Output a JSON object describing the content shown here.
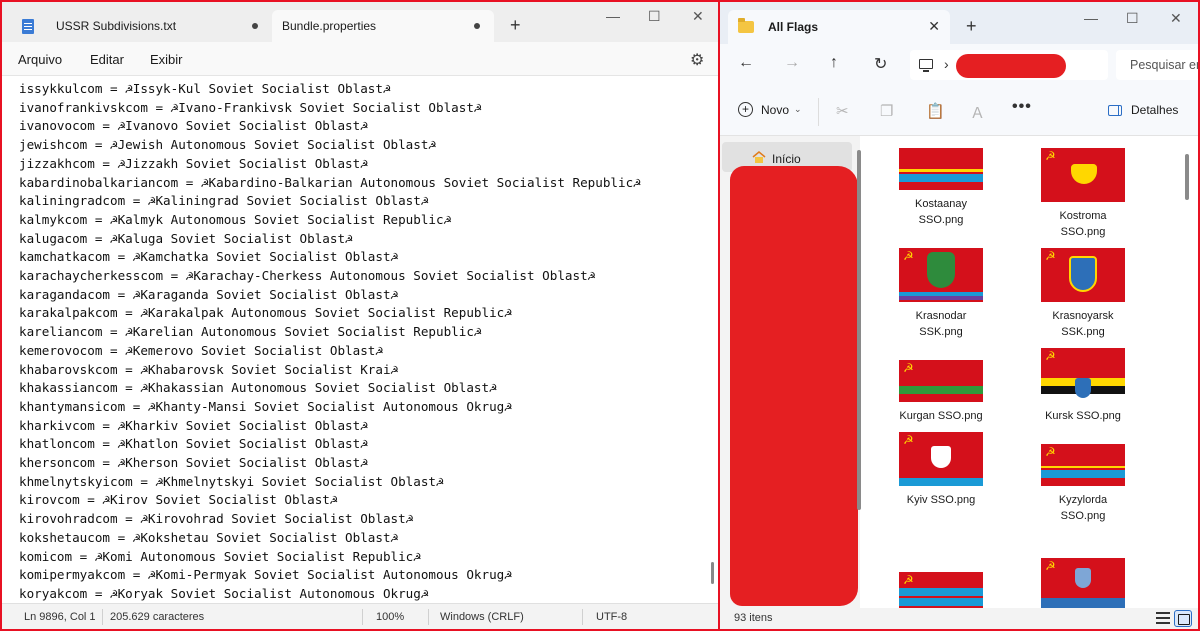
{
  "notepad": {
    "tabs": [
      {
        "label": "USSR Subdivisions.txt",
        "modified": true
      },
      {
        "label": "Bundle.properties",
        "modified": true,
        "active": true
      }
    ],
    "menu": [
      "Arquivo",
      "Editar",
      "Exibir"
    ],
    "lines": [
      "issykkulcom = ☭Issyk-Kul Soviet Socialist Oblast☭",
      "ivanofrankivskcom = ☭Ivano-Frankivsk Soviet Socialist Oblast☭",
      "ivanovocom = ☭Ivanovo Soviet Socialist Oblast☭",
      "jewishcom = ☭Jewish Autonomous Soviet Socialist Oblast☭",
      "jizzakhcom = ☭Jizzakh Soviet Socialist Oblast☭",
      "kabardinobalkariancom = ☭Kabardino-Balkarian Autonomous Soviet Socialist Republic☭",
      "kaliningradcom = ☭Kaliningrad Soviet Socialist Oblast☭",
      "kalmykcom = ☭Kalmyk Autonomous Soviet Socialist Republic☭",
      "kalugacom = ☭Kaluga Soviet Socialist Oblast☭",
      "kamchatkacom = ☭Kamchatka Soviet Socialist Oblast☭",
      "karachaycherkesscom = ☭Karachay-Cherkess Autonomous Soviet Socialist Oblast☭",
      "karagandacom = ☭Karaganda Soviet Socialist Oblast☭",
      "karakalpakcom = ☭Karakalpak Autonomous Soviet Socialist Republic☭",
      "kareliancom = ☭Karelian Autonomous Soviet Socialist Republic☭",
      "kemerovocom = ☭Kemerovo Soviet Socialist Oblast☭",
      "khabarovskcom = ☭Khabarovsk Soviet Socialist Krai☭",
      "khakassiancom = ☭Khakassian Autonomous Soviet Socialist Oblast☭",
      "khantymansicom = ☭Khanty-Mansi Soviet Socialist Autonomous Okrug☭",
      "kharkivcom = ☭Kharkiv Soviet Socialist Oblast☭",
      "khatloncom = ☭Khatlon Soviet Socialist Oblast☭",
      "khersoncom = ☭Kherson Soviet Socialist Oblast☭",
      "khmelnytskyicom = ☭Khmelnytskyi Soviet Socialist Oblast☭",
      "kirovcom = ☭Kirov Soviet Socialist Oblast☭",
      "kirovohradcom = ☭Kirovohrad Soviet Socialist Oblast☭",
      "kokshetaucom = ☭Kokshetau Soviet Socialist Oblast☭",
      "komicom = ☭Komi Autonomous Soviet Socialist Republic☭",
      "komipermyakcom = ☭Komi-Permyak Soviet Socialist Autonomous Okrug☭",
      "koryakcom = ☭Koryak Soviet Socialist Autonomous Okrug☭"
    ],
    "status": {
      "position": "Ln 9896, Col 1",
      "characters": "205.629 caracteres",
      "zoom": "100%",
      "line_endings": "Windows (CRLF)",
      "encoding": "UTF-8"
    }
  },
  "explorer": {
    "tab_title": "All Flags",
    "search_placeholder": "Pesquisar em",
    "new_label": "Novo",
    "details_label": "Detalhes",
    "home_label": "Início",
    "item_count": "93 itens",
    "files": [
      {
        "line1": "Kostaanay",
        "line2": "SSO.png"
      },
      {
        "line1": "Kostroma",
        "line2": "SSO.png"
      },
      {
        "line1": "Krasnodar",
        "line2": "SSK.png"
      },
      {
        "line1": "Krasnoyarsk",
        "line2": "SSK.png"
      },
      {
        "line1": "Kurgan SSO.png",
        "line2": ""
      },
      {
        "line1": "Kursk SSO.png",
        "line2": ""
      },
      {
        "line1": "Kyiv SSO.png",
        "line2": ""
      },
      {
        "line1": "Kyzylorda",
        "line2": "SSO.png"
      },
      {
        "line1": "",
        "line2": ""
      },
      {
        "line1": "",
        "line2": ""
      }
    ],
    "colors": {
      "flag_red": "#d4101b",
      "flag_blue": "#1a9ad6",
      "flag_gold": "#ffd700",
      "redaction": "#e51f22"
    }
  }
}
